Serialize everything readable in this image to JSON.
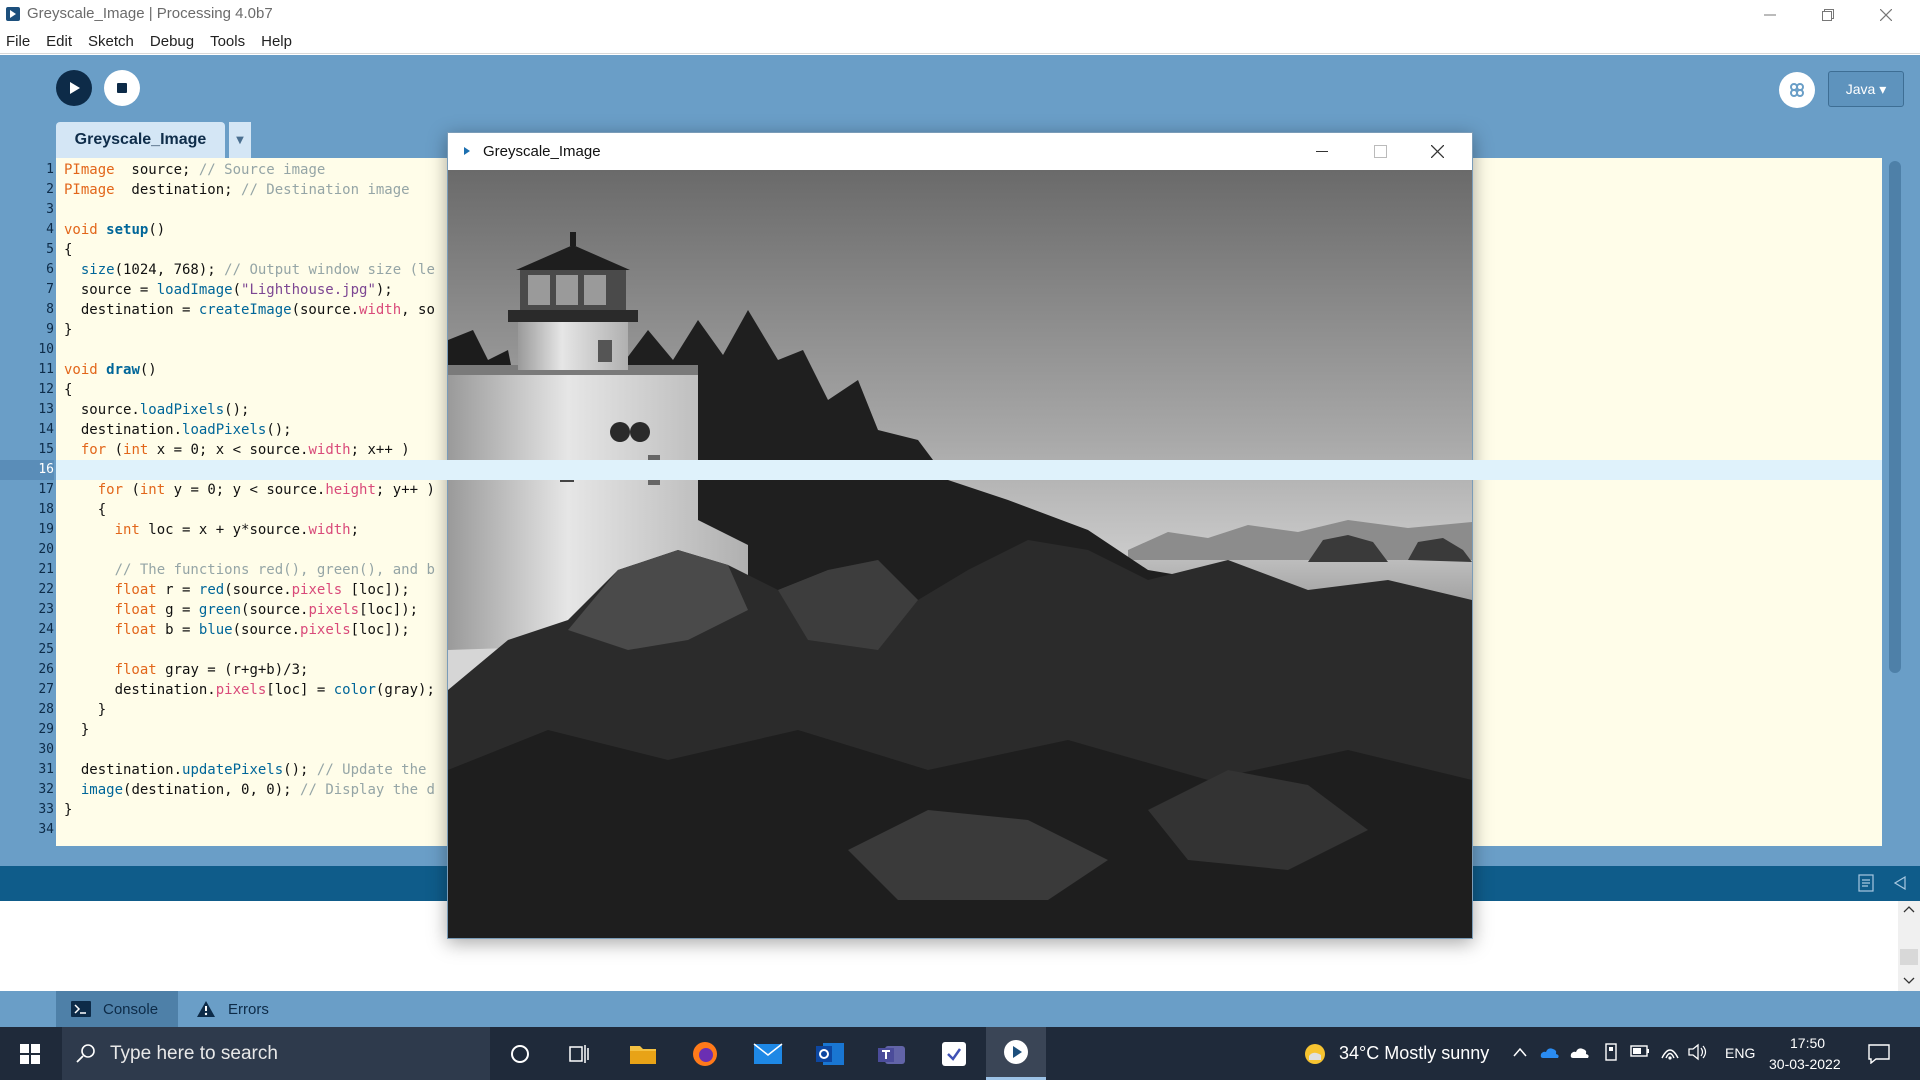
{
  "window": {
    "title": "Greyscale_Image | Processing 4.0b7"
  },
  "menu": [
    "File",
    "Edit",
    "Sketch",
    "Debug",
    "Tools",
    "Help"
  ],
  "toolbar": {
    "mode_label": "Java ▾"
  },
  "editor": {
    "tab_label": "Greyscale_Image",
    "current_line": 16,
    "lines": [
      {
        "n": "1",
        "t": [
          [
            "kw",
            "PImage"
          ],
          [
            "",
            ""
          ],
          [
            "",
            "  source; "
          ],
          [
            "cmt",
            "// Source image"
          ]
        ]
      },
      {
        "n": "2",
        "t": [
          [
            "kw",
            "PImage"
          ],
          [
            "",
            "  destination; "
          ],
          [
            "cmt",
            "// Destination image"
          ]
        ]
      },
      {
        "n": "3",
        "t": []
      },
      {
        "n": "4",
        "t": [
          [
            "kw",
            "void"
          ],
          [
            "",
            " "
          ],
          [
            "fnb",
            "setup"
          ],
          [
            "",
            "()"
          ]
        ]
      },
      {
        "n": "5",
        "t": [
          [
            "",
            "{"
          ]
        ]
      },
      {
        "n": "6",
        "t": [
          [
            "",
            "  "
          ],
          [
            "fn",
            "size"
          ],
          [
            "",
            "(1024, 768); "
          ],
          [
            "cmt",
            "// Output window size (le"
          ]
        ]
      },
      {
        "n": "7",
        "t": [
          [
            "",
            "  source = "
          ],
          [
            "fn",
            "loadImage"
          ],
          [
            "",
            "("
          ],
          [
            "str",
            "\"Lighthouse.jpg\""
          ],
          [
            "",
            ");"
          ]
        ]
      },
      {
        "n": "8",
        "t": [
          [
            "",
            "  destination = "
          ],
          [
            "fn",
            "createImage"
          ],
          [
            "",
            "(source."
          ],
          [
            "prop",
            "width"
          ],
          [
            "",
            ", so"
          ]
        ]
      },
      {
        "n": "9",
        "t": [
          [
            "",
            "}"
          ]
        ]
      },
      {
        "n": "10",
        "t": []
      },
      {
        "n": "11",
        "t": [
          [
            "kw",
            "void"
          ],
          [
            "",
            " "
          ],
          [
            "fnb",
            "draw"
          ],
          [
            "",
            "()"
          ]
        ]
      },
      {
        "n": "12",
        "t": [
          [
            "",
            "{"
          ]
        ]
      },
      {
        "n": "13",
        "t": [
          [
            "",
            "  source."
          ],
          [
            "fn",
            "loadPixels"
          ],
          [
            "",
            "();"
          ]
        ]
      },
      {
        "n": "14",
        "t": [
          [
            "",
            "  destination."
          ],
          [
            "fn",
            "loadPixels"
          ],
          [
            "",
            "();"
          ]
        ]
      },
      {
        "n": "15",
        "t": [
          [
            "",
            "  "
          ],
          [
            "kw",
            "for"
          ],
          [
            "",
            " ("
          ],
          [
            "kw",
            "int"
          ],
          [
            "",
            " x = 0; x < source."
          ],
          [
            "prop",
            "width"
          ],
          [
            "",
            "; x++ )"
          ]
        ]
      },
      {
        "n": "16",
        "t": [
          [
            "",
            "  {"
          ]
        ]
      },
      {
        "n": "17",
        "t": [
          [
            "",
            "    "
          ],
          [
            "kw",
            "for"
          ],
          [
            "",
            " ("
          ],
          [
            "kw",
            "int"
          ],
          [
            "",
            " y = 0; y < source."
          ],
          [
            "prop",
            "height"
          ],
          [
            "",
            "; y++ )"
          ]
        ]
      },
      {
        "n": "18",
        "t": [
          [
            "",
            "    {"
          ]
        ]
      },
      {
        "n": "19",
        "t": [
          [
            "",
            "      "
          ],
          [
            "kw",
            "int"
          ],
          [
            "",
            " loc = x + y*source."
          ],
          [
            "prop",
            "width"
          ],
          [
            "",
            ";"
          ]
        ]
      },
      {
        "n": "20",
        "t": []
      },
      {
        "n": "21",
        "t": [
          [
            "",
            "      "
          ],
          [
            "cmt",
            "// The functions red(), green(), and b"
          ]
        ]
      },
      {
        "n": "22",
        "t": [
          [
            "",
            "      "
          ],
          [
            "kw",
            "float"
          ],
          [
            "",
            " r = "
          ],
          [
            "fn",
            "red"
          ],
          [
            "",
            "(source."
          ],
          [
            "prop",
            "pixels"
          ],
          [
            "",
            " [loc]);"
          ]
        ]
      },
      {
        "n": "23",
        "t": [
          [
            "",
            "      "
          ],
          [
            "kw",
            "float"
          ],
          [
            "",
            " g = "
          ],
          [
            "fn",
            "green"
          ],
          [
            "",
            "(source."
          ],
          [
            "prop",
            "pixels"
          ],
          [
            "",
            "[loc]);"
          ]
        ]
      },
      {
        "n": "24",
        "t": [
          [
            "",
            "      "
          ],
          [
            "kw",
            "float"
          ],
          [
            "",
            " b = "
          ],
          [
            "fn",
            "blue"
          ],
          [
            "",
            "(source."
          ],
          [
            "prop",
            "pixels"
          ],
          [
            "",
            "[loc]);"
          ]
        ]
      },
      {
        "n": "25",
        "t": []
      },
      {
        "n": "26",
        "t": [
          [
            "",
            "      "
          ],
          [
            "kw",
            "float"
          ],
          [
            "",
            " gray = (r+g+b)/3;"
          ]
        ]
      },
      {
        "n": "27",
        "t": [
          [
            "",
            "      destination."
          ],
          [
            "prop",
            "pixels"
          ],
          [
            "",
            "[loc] = "
          ],
          [
            "fn",
            "color"
          ],
          [
            "",
            "(gray);"
          ]
        ]
      },
      {
        "n": "28",
        "t": [
          [
            "",
            "    }"
          ]
        ]
      },
      {
        "n": "29",
        "t": [
          [
            "",
            "  }"
          ]
        ]
      },
      {
        "n": "30",
        "t": []
      },
      {
        "n": "31",
        "t": [
          [
            "",
            "  destination."
          ],
          [
            "fn",
            "updatePixels"
          ],
          [
            "",
            "(); "
          ],
          [
            "cmt",
            "// Update the"
          ]
        ]
      },
      {
        "n": "32",
        "t": [
          [
            "",
            "  "
          ],
          [
            "fn",
            "image"
          ],
          [
            "",
            "(destination, 0, 0); "
          ],
          [
            "cmt",
            "// Display the d"
          ]
        ]
      },
      {
        "n": "33",
        "t": [
          [
            "",
            "}"
          ]
        ]
      },
      {
        "n": "34",
        "t": []
      }
    ]
  },
  "sketch_window": {
    "title": "Greyscale_Image"
  },
  "bottom_tabs": {
    "console": "Console",
    "errors": "Errors"
  },
  "taskbar": {
    "search_placeholder": "Type here to search",
    "weather": "34°C  Mostly sunny",
    "language": "ENG",
    "time": "17:50",
    "date": "30-03-2022"
  },
  "colors": {
    "toolbar": "#6a9ec7",
    "editor_bg": "#fffde9",
    "keyword": "#e2661a",
    "function": "#006699",
    "comment": "#95a5a6",
    "string": "#7d4793"
  }
}
